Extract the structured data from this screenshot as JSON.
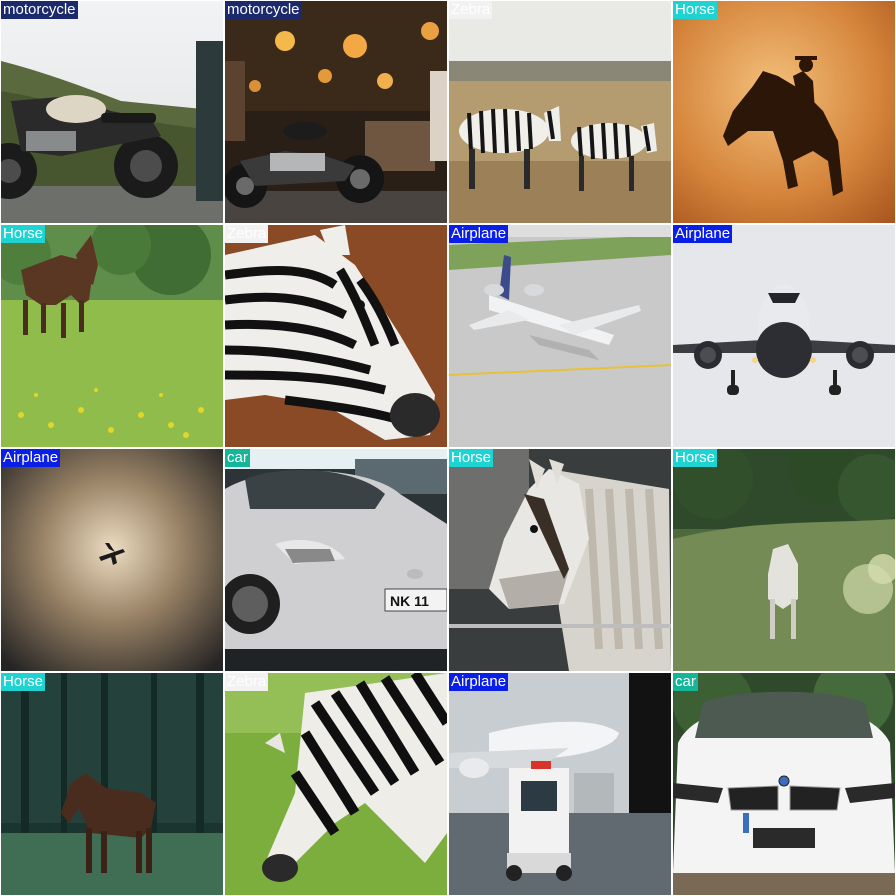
{
  "label_colors": {
    "motorcycle": "#1a2a6c",
    "Zebra": "#f2f2f2",
    "Horse": "#1fd3d3",
    "Airplane": "#0a1fe6",
    "car": "#15b59a"
  },
  "tiles": [
    {
      "label": "motorcycle",
      "scene": "motorcycle on grassy hill"
    },
    {
      "label": "motorcycle",
      "scene": "motorcycle in lamp shop"
    },
    {
      "label": "Zebra",
      "scene": "two zebras on savanna"
    },
    {
      "label": "Horse",
      "scene": "rider on rearing horse at sunset"
    },
    {
      "label": "Horse",
      "scene": "brown horse in flower meadow"
    },
    {
      "label": "Zebra",
      "scene": "zebra head close-up"
    },
    {
      "label": "Airplane",
      "scene": "jet on taxiway"
    },
    {
      "label": "Airplane",
      "scene": "airliner front view landing"
    },
    {
      "label": "Airplane",
      "scene": "plane silhouette in hazy sky"
    },
    {
      "label": "car",
      "scene": "silver sports car front"
    },
    {
      "label": "Horse",
      "scene": "white horse with braided mane"
    },
    {
      "label": "Horse",
      "scene": "white horse in green field"
    },
    {
      "label": "Horse",
      "scene": "dark horse in foggy forest"
    },
    {
      "label": "Zebra",
      "scene": "zebra grazing on grass"
    },
    {
      "label": "Airplane",
      "scene": "airliner with tug at gate"
    },
    {
      "label": "car",
      "scene": "white car front grille"
    }
  ]
}
